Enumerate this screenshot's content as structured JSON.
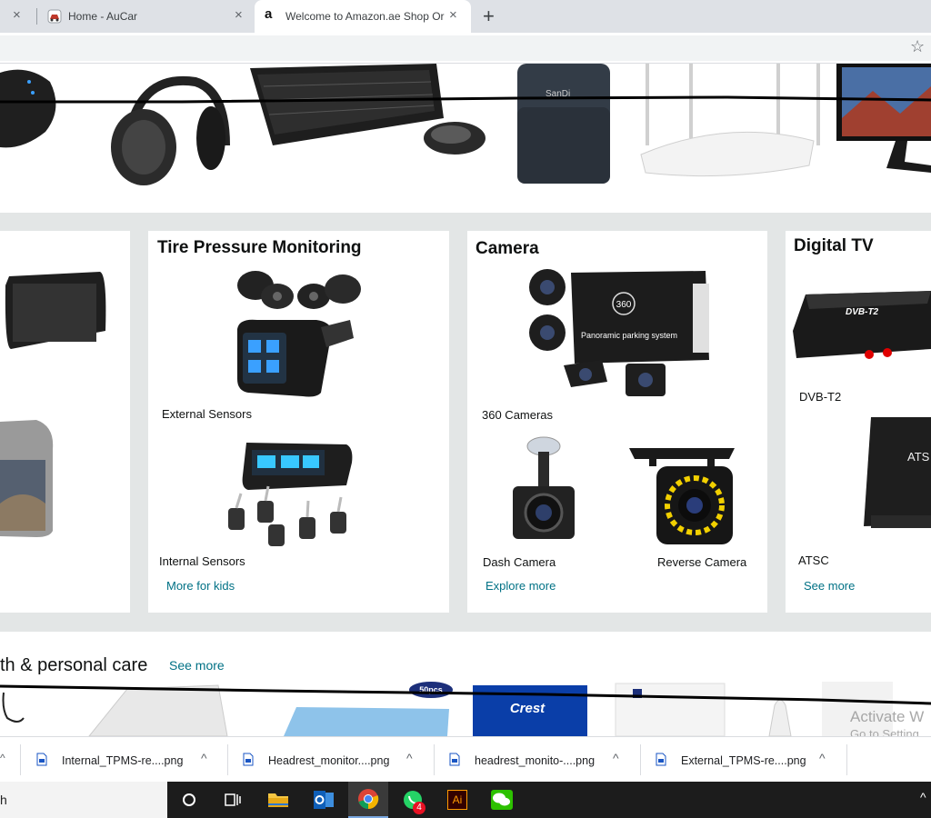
{
  "browser": {
    "tabs": [
      {
        "title": "Home - AuCar"
      },
      {
        "title": "Welcome to Amazon.ae Shop Or"
      }
    ],
    "new_tab_symbol": "+",
    "close_symbol": "×",
    "bookmark_symbol": "☆"
  },
  "cards": [
    {
      "title": "Tire Pressure Monitoring",
      "items": [
        {
          "label": "External Sensors"
        },
        {
          "label": "Internal Sensors"
        }
      ],
      "link": "More for kids"
    },
    {
      "title": "Camera",
      "items": [
        {
          "label": "360 Cameras"
        },
        {
          "label": "Dash Camera"
        },
        {
          "label": "Reverse Camera"
        }
      ],
      "link": "Explore more",
      "parking_box_text": "Panoramic parking system",
      "parking_box_badge": "360"
    },
    {
      "title": "Digital TV",
      "items": [
        {
          "label": "DVB-T2"
        },
        {
          "label": "ATSC"
        }
      ],
      "link": "See more",
      "dvb_box_text": "DVB-T2",
      "atsc_box_text": "ATS"
    }
  ],
  "health": {
    "title": "th & personal care",
    "link": "See more",
    "badge": "50pcs",
    "crest": "Crest"
  },
  "watermark": {
    "line1": "Activate W",
    "line2": "Go to Setting"
  },
  "downloads": [
    {
      "name": "Internal_TPMS-re....png"
    },
    {
      "name": "Headrest_monitor....png"
    },
    {
      "name": "headrest_monito-....png"
    },
    {
      "name": "External_TPMS-re....png"
    }
  ],
  "taskbar": {
    "search_text": "h",
    "whatsapp_badge": "4",
    "ai_label": "Ai"
  },
  "colors": {
    "link": "#007185",
    "page_bg": "#e3e6e6",
    "taskbar_bg": "#1c1c1c"
  }
}
